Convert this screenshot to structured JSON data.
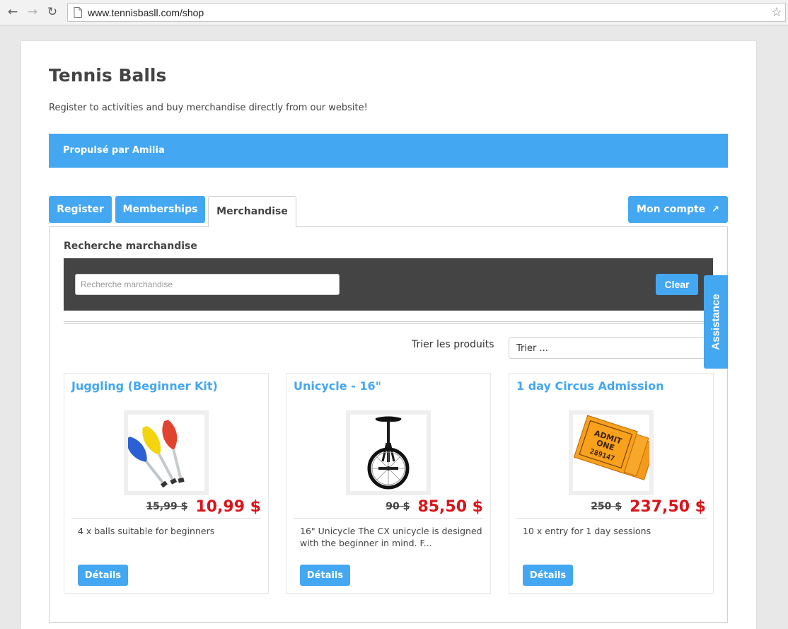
{
  "browser": {
    "url": "www.tennisbasll.com/shop"
  },
  "header": {
    "title": "Tennis Balls",
    "subtitle": "Register to activities and buy merchandise directly from our website!",
    "banner": "Propulsé par Amilia"
  },
  "tabs": {
    "register": "Register",
    "memberships": "Memberships",
    "merchandise": "Merchandise",
    "account": "Mon compte",
    "active": "Merchandise"
  },
  "search": {
    "heading": "Recherche marchandise",
    "placeholder": "Recherche marchandise",
    "value": "",
    "clear_label": "Clear"
  },
  "sort": {
    "label": "Trier les produits",
    "value": "Trier ..."
  },
  "products": [
    {
      "name": "Juggling (Beginner Kit)",
      "icon": "juggling-clubs-image",
      "old_price": "15,99 $",
      "price": "10,99 $",
      "description": "4 x balls suitable for beginners",
      "button_label": "Détails"
    },
    {
      "name": "Unicycle - 16\"",
      "icon": "unicycle-image",
      "old_price": "90 $",
      "price": "85,50 $",
      "description": "16\" Unicycle The CX unicycle is designed with the beginner in mind. F...",
      "button_label": "Détails"
    },
    {
      "name": "1 day Circus Admission",
      "icon": "admit-one-tickets-image",
      "old_price": "250 $",
      "price": "237,50 $",
      "description": "10 x entry for 1 day sessions",
      "button_label": "Détails"
    }
  ],
  "ticket_image": {
    "admit": "ADMIT",
    "one": "ONE",
    "number": "289147"
  },
  "assistance_label": "Assistance",
  "colors": {
    "accent": "#44a7f2",
    "price_red": "#d9141b",
    "search_bar": "#444444"
  }
}
